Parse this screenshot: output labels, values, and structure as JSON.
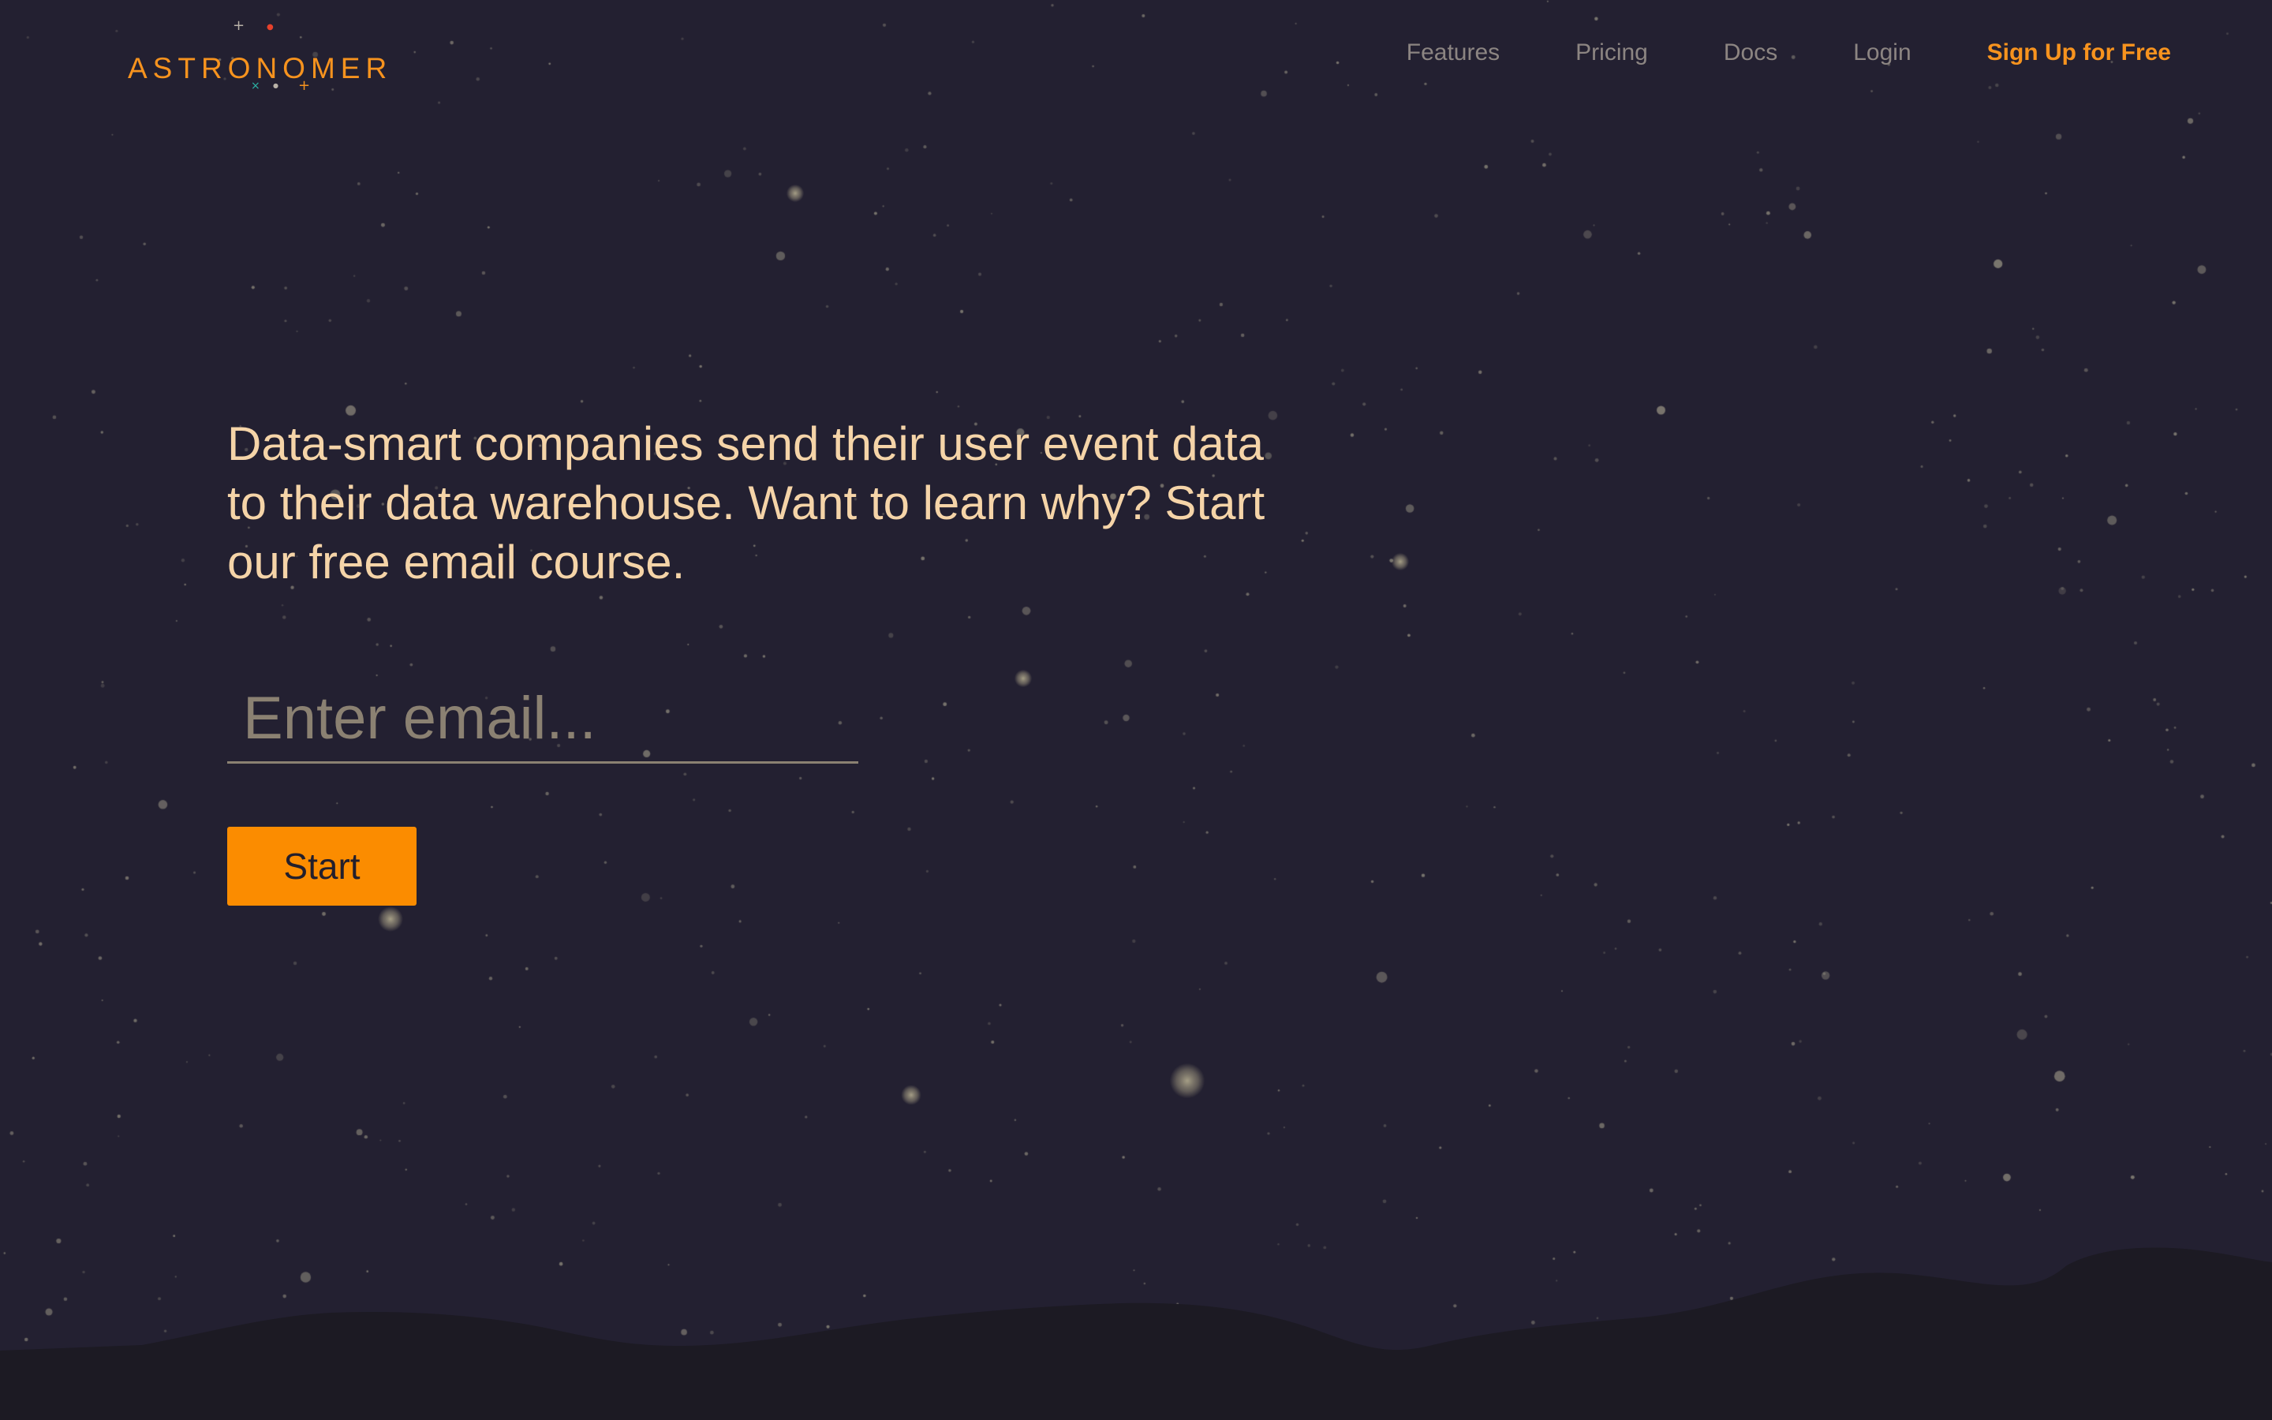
{
  "brand": {
    "name": "ASTRONOMER",
    "accent_color": "#f7931e",
    "logo_star_colors": [
      "#b9b2a8",
      "#e6412b",
      "#2bb3a5",
      "#f7931e",
      "#b9b2a8"
    ]
  },
  "nav": {
    "items": [
      {
        "label": "Features"
      },
      {
        "label": "Pricing"
      },
      {
        "label": "Docs"
      },
      {
        "label": "Login"
      }
    ],
    "cta_label": "Sign Up for Free"
  },
  "hero": {
    "headline": "Data-smart companies send their user event data to their data warehouse. Want to learn why? Start our free email course.",
    "email_placeholder": "Enter email...",
    "email_value": "",
    "start_label": "Start"
  },
  "theme": {
    "background": "#232031",
    "ground": "#1c1a23",
    "headline_color": "#f5d4a8",
    "button_color": "#fb8c00",
    "nav_color": "#8c8582"
  }
}
